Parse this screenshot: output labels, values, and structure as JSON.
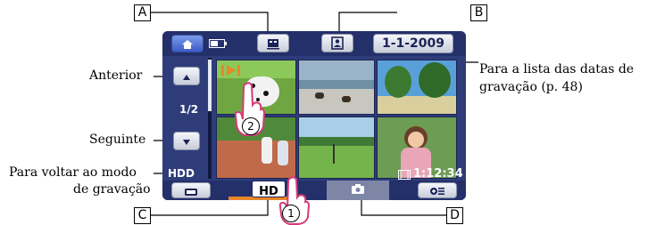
{
  "callouts": {
    "a": "A",
    "b": "B",
    "c": "C",
    "d": "D"
  },
  "labels": {
    "anterior": "Anterior",
    "seguinte": "Seguinte",
    "voltar_line1": "Para voltar ao modo",
    "voltar_line2": "de gravação",
    "lista_line1": "Para a lista das datas de",
    "lista_line2": "gravação (p. 48)"
  },
  "screen": {
    "date_button": "1-1-2009",
    "page_indicator": "1/2",
    "storage": "HDD",
    "duration": "1:12:34",
    "hd_button": "HD"
  },
  "markers": {
    "step1": "1",
    "step2": "2"
  },
  "icons": {
    "home": "home-icon",
    "battery": "battery-icon",
    "film": "film-strip-icon",
    "person": "person-frame-icon",
    "up": "up-arrow-icon",
    "down": "down-arrow-icon",
    "play": "play-icon",
    "rec": "camcorder-mode-icon",
    "camera": "camera-icon",
    "options": "options-icon",
    "hand": "pointing-hand-icon"
  },
  "colors": {
    "screen": "#2e3d7a",
    "accent": "#e8862a"
  }
}
